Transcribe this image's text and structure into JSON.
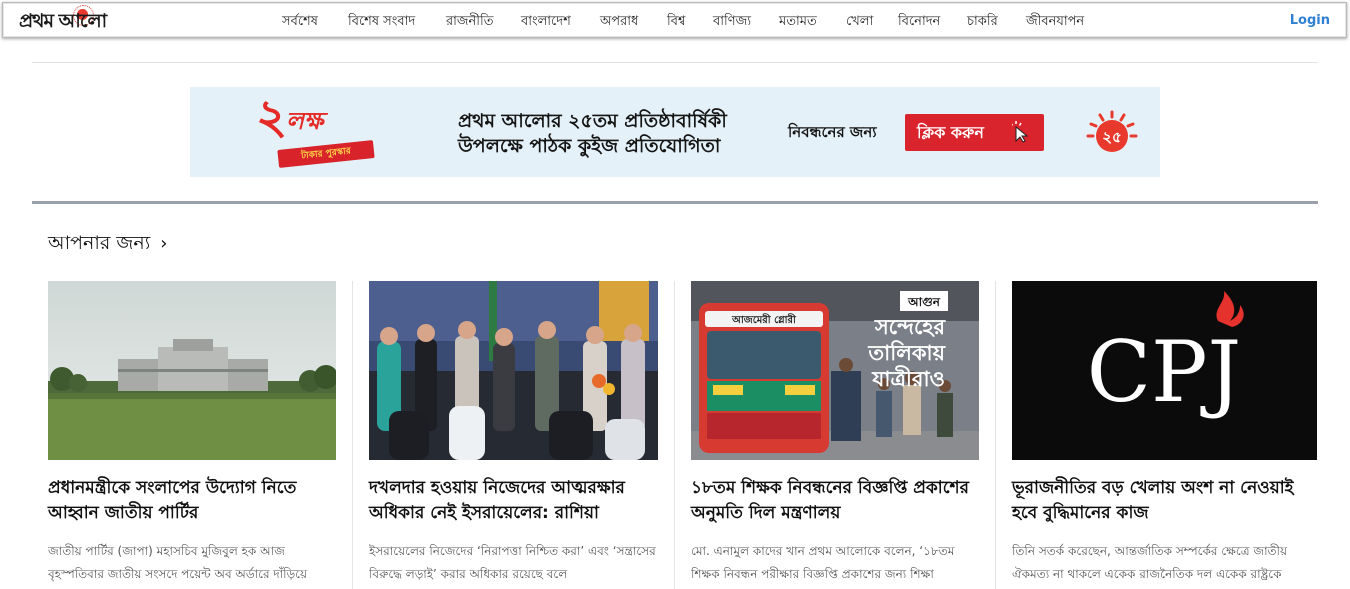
{
  "header": {
    "logo_text": "প্রথম আলো",
    "nav": [
      "সর্বশেষ",
      "বিশেষ সংবাদ",
      "রাজনীতি",
      "বাংলাদেশ",
      "অপরাধ",
      "বিশ্ব",
      "বাণিজ্য",
      "মতামত",
      "খেলা",
      "বিনোদন",
      "চাকরি",
      "জীবনযাপন"
    ],
    "login_label": "Login"
  },
  "banner": {
    "badge_number": "২",
    "badge_word": "লক্ষ",
    "badge_ribbon": "টাকার পুরস্কার",
    "line1": "প্রথম আলোর ২৫তম প্রতিষ্ঠাবার্ষিকী",
    "line2": "উপলক্ষে পাঠক কুইজ প্রতিযোগিতা",
    "register_label": "নিবন্ধনের জন্য",
    "button_label": "ক্লিক করুন",
    "anniversary_mark": "২৫"
  },
  "section": {
    "title": "আপনার জন্য",
    "chevron": "›"
  },
  "cards": [
    {
      "title": "প্রধানমন্ত্রীকে সংলাপের উদ্যোগ নিতে আহ্বান জাতীয় পার্টির",
      "summary": "জাতীয় পার্টির (জাপা) মহাসচিব মুজিবুল হক আজ বৃহস্পতিবার জাতীয় সংসদে পয়েন্ট অব অর্ডারে দাঁড়িয়ে"
    },
    {
      "title": "দখলদার হওয়ায় নিজেদের আত্মরক্ষার অধিকার নেই ইসরায়েলের: রাশিয়া",
      "summary": "ইসরায়েলের নিজেদের ‘নিরাপত্তা নিশ্চিত করা’ এবং ‘সন্ত্রাসের বিরুদ্ধে লড়াই’ করার অধিকার রয়েছে বলে"
    },
    {
      "title": "১৮তম শিক্ষক নিবন্ধনের বিজ্ঞপ্তি প্রকাশের অনুমতি দিল মন্ত্রণালয়",
      "summary": "মো. এনামুল কাদের খান প্রথম আলোকে বলেন, ‘১৮তম শিক্ষক নিবন্ধন পরীক্ষার বিজ্ঞপ্তি প্রকাশের জন্য শিক্ষা",
      "overlay_tag": "আগুন",
      "overlay_lines": [
        "সন্দেহের",
        "তালিকায়",
        "যাত্রীরাও"
      ],
      "bus_sign": "আজমেরী গ্লোরী"
    },
    {
      "title": "ভূরাজনীতির বড় খেলায় অংশ না নেওয়াই হবে বুদ্ধিমানের কাজ",
      "summary": "তিনি সতর্ক করেছেন, আন্তর্জাতিক সম্পর্কের ক্ষেত্রে জাতীয় ঐকমত্য না থাকলে একেক রাজনৈতিক দল একেক রাষ্ট্রকে",
      "logo_text": "CPJ"
    }
  ],
  "colors": {
    "accent_red": "#d9232d",
    "login_blue": "#2f7fd2",
    "banner_bg": "#e5f1f8"
  }
}
